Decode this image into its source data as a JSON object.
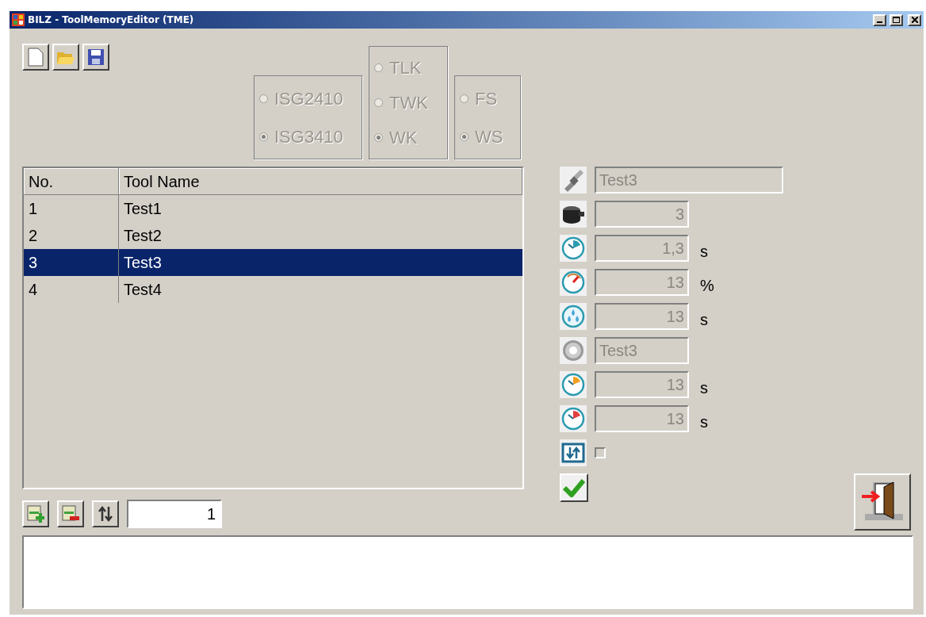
{
  "window": {
    "title": "BILZ - ToolMemoryEditor (TME)"
  },
  "radio_groups": [
    {
      "disabled": true,
      "options": [
        {
          "label": "ISG2410",
          "selected": false
        },
        {
          "label": "ISG3410",
          "selected": true
        }
      ]
    },
    {
      "disabled": true,
      "options": [
        {
          "label": "TLK",
          "selected": false
        },
        {
          "label": "TWK",
          "selected": false
        },
        {
          "label": "WK",
          "selected": true
        }
      ]
    },
    {
      "disabled": true,
      "options": [
        {
          "label": "FS",
          "selected": false
        },
        {
          "label": "WS",
          "selected": true
        }
      ]
    }
  ],
  "table": {
    "columns": [
      "No.",
      "Tool Name"
    ],
    "rows": [
      {
        "cells": [
          "1",
          "Test1"
        ],
        "selected": false
      },
      {
        "cells": [
          "2",
          "Test2"
        ],
        "selected": false
      },
      {
        "cells": [
          "3",
          "Test3"
        ],
        "selected": true
      },
      {
        "cells": [
          "4",
          "Test4"
        ],
        "selected": false
      }
    ]
  },
  "properties": [
    {
      "kind": "wide_text",
      "value": "Test3",
      "disabled": true
    },
    {
      "kind": "number",
      "value": "3",
      "disabled": true
    },
    {
      "kind": "number",
      "value": "1,3",
      "unit": "s",
      "disabled": true
    },
    {
      "kind": "number",
      "value": "13",
      "unit": "%",
      "disabled": true
    },
    {
      "kind": "number",
      "value": "13",
      "unit": "s",
      "disabled": true
    },
    {
      "kind": "text",
      "value": "Test3",
      "disabled": true
    },
    {
      "kind": "number",
      "value": "13",
      "unit": "s",
      "disabled": true
    },
    {
      "kind": "number",
      "value": "13",
      "unit": "s",
      "disabled": true
    },
    {
      "kind": "checkbox",
      "checked": false
    }
  ],
  "counter": {
    "value": "1"
  }
}
